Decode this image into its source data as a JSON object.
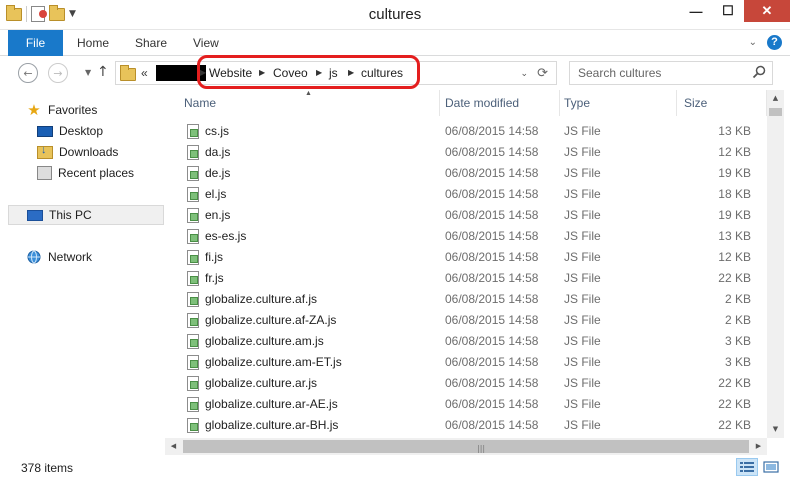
{
  "window": {
    "title": "cultures",
    "minimize": "—",
    "maximize": "☐",
    "close": "✕"
  },
  "ribbon": {
    "tabs": [
      "File",
      "Home",
      "Share",
      "View"
    ]
  },
  "address": {
    "overflow": "«",
    "crumbs": [
      "Website",
      "Coveo",
      "js",
      "cultures"
    ],
    "dropdown_glyph": "⌄",
    "refresh_glyph": "⟳"
  },
  "search": {
    "placeholder": "Search cultures"
  },
  "sidebar": {
    "items": [
      {
        "label": "Favorites",
        "icon": "star-icon"
      },
      {
        "label": "Desktop",
        "icon": "desktop-icon"
      },
      {
        "label": "Downloads",
        "icon": "downloads-icon"
      },
      {
        "label": "Recent places",
        "icon": "recent-places-icon"
      },
      {
        "label": "This PC",
        "icon": "this-pc-icon"
      },
      {
        "label": "Network",
        "icon": "network-icon"
      }
    ]
  },
  "columns": [
    "Name",
    "Date modified",
    "Type",
    "Size"
  ],
  "files": [
    {
      "name": "cs.js",
      "date": "06/08/2015 14:58",
      "type": "JS File",
      "size": "13 KB"
    },
    {
      "name": "da.js",
      "date": "06/08/2015 14:58",
      "type": "JS File",
      "size": "12 KB"
    },
    {
      "name": "de.js",
      "date": "06/08/2015 14:58",
      "type": "JS File",
      "size": "19 KB"
    },
    {
      "name": "el.js",
      "date": "06/08/2015 14:58",
      "type": "JS File",
      "size": "18 KB"
    },
    {
      "name": "en.js",
      "date": "06/08/2015 14:58",
      "type": "JS File",
      "size": "19 KB"
    },
    {
      "name": "es-es.js",
      "date": "06/08/2015 14:58",
      "type": "JS File",
      "size": "13 KB"
    },
    {
      "name": "fi.js",
      "date": "06/08/2015 14:58",
      "type": "JS File",
      "size": "12 KB"
    },
    {
      "name": "fr.js",
      "date": "06/08/2015 14:58",
      "type": "JS File",
      "size": "22 KB"
    },
    {
      "name": "globalize.culture.af.js",
      "date": "06/08/2015 14:58",
      "type": "JS File",
      "size": "2 KB"
    },
    {
      "name": "globalize.culture.af-ZA.js",
      "date": "06/08/2015 14:58",
      "type": "JS File",
      "size": "2 KB"
    },
    {
      "name": "globalize.culture.am.js",
      "date": "06/08/2015 14:58",
      "type": "JS File",
      "size": "3 KB"
    },
    {
      "name": "globalize.culture.am-ET.js",
      "date": "06/08/2015 14:58",
      "type": "JS File",
      "size": "3 KB"
    },
    {
      "name": "globalize.culture.ar.js",
      "date": "06/08/2015 14:58",
      "type": "JS File",
      "size": "22 KB"
    },
    {
      "name": "globalize.culture.ar-AE.js",
      "date": "06/08/2015 14:58",
      "type": "JS File",
      "size": "22 KB"
    },
    {
      "name": "globalize.culture.ar-BH.js",
      "date": "06/08/2015 14:58",
      "type": "JS File",
      "size": "22 KB"
    }
  ],
  "status": {
    "count": "378 items"
  },
  "colors": {
    "accent": "#1979ca",
    "highlight_border": "#e41e1e",
    "close_button": "#c7473a"
  }
}
